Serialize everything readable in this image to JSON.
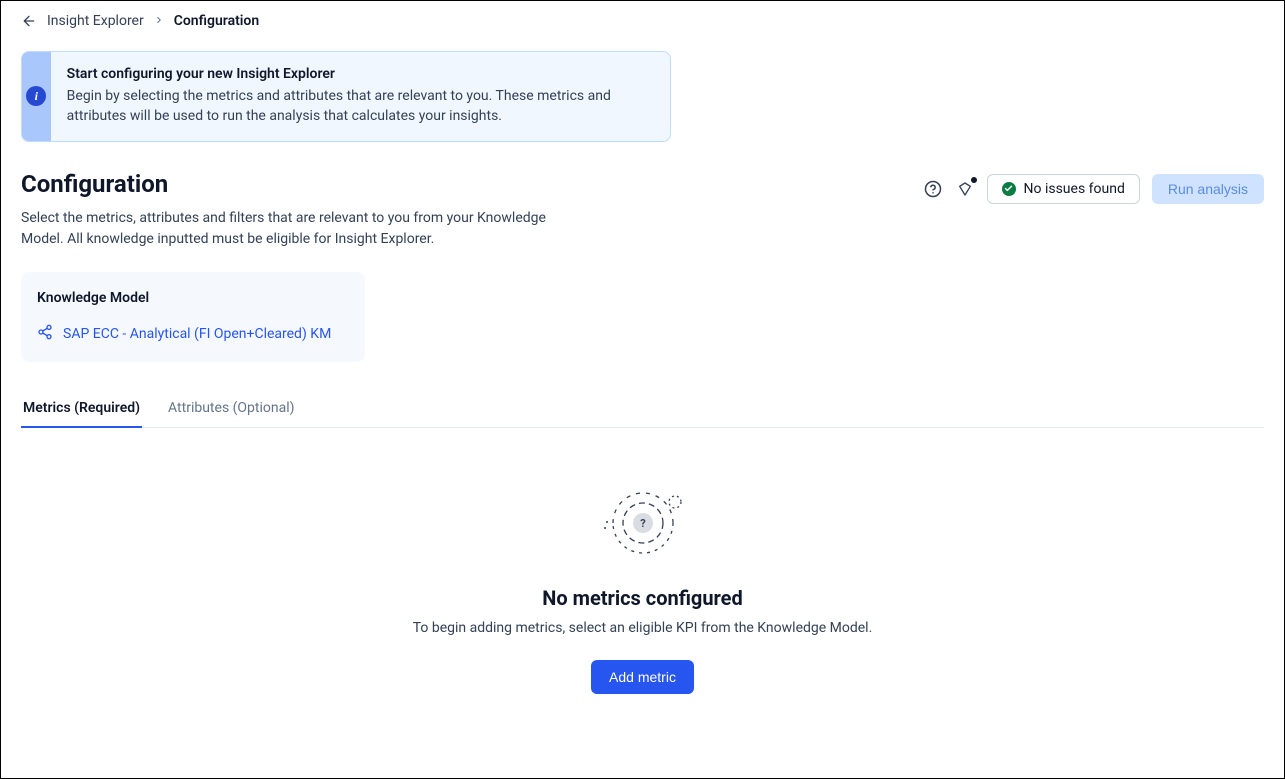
{
  "breadcrumb": {
    "parent": "Insight Explorer",
    "current": "Configuration"
  },
  "info_banner": {
    "title": "Start configuring your new Insight Explorer",
    "text": "Begin by selecting the metrics and attributes that are relevant to you. These metrics and attributes will be used to run the analysis that calculates your insights."
  },
  "page": {
    "title": "Configuration",
    "subtitle": "Select the metrics, attributes and filters that are relevant to you from your Knowledge Model. All knowledge inputted must be eligible for Insight Explorer."
  },
  "header_actions": {
    "status_label": "No issues found",
    "run_label": "Run analysis"
  },
  "km_card": {
    "title": "Knowledge Model",
    "link_label": "SAP ECC - Analytical (FI Open+Cleared) KM"
  },
  "tabs": [
    {
      "label": "Metrics (Required)",
      "active": true
    },
    {
      "label": "Attributes (Optional)",
      "active": false
    }
  ],
  "empty_state": {
    "title": "No metrics configured",
    "text": "To begin adding metrics, select an eligible KPI from the Knowledge Model.",
    "button": "Add metric"
  },
  "colors": {
    "primary": "#2755f0",
    "success": "#0a7c41",
    "banner_bg": "#f1f7ff",
    "banner_stripe": "#a9c7fb",
    "run_bg": "#cfe2ff"
  }
}
